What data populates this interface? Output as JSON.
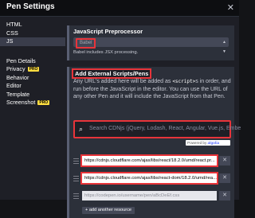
{
  "header": {
    "title": "Pen Settings",
    "close_label": "✕"
  },
  "sidebar": {
    "groups": [
      [
        {
          "label": "HTML"
        },
        {
          "label": "CSS"
        },
        {
          "label": "JS",
          "active": true
        }
      ],
      [
        {
          "label": "Pen Details"
        },
        {
          "label": "Privacy",
          "badge": "PRO"
        },
        {
          "label": "Behavior"
        },
        {
          "label": "Editor"
        },
        {
          "label": "Template"
        },
        {
          "label": "Screenshot",
          "badge": "PRO"
        }
      ]
    ]
  },
  "preprocessor": {
    "title": "JavaScript Preprocessor",
    "selected": "Babel",
    "help": "Babel includes JSX processing."
  },
  "external": {
    "title": "Add External Scripts/Pens",
    "desc_before": "Any URL's added here will be added as ",
    "desc_code": "<script>",
    "desc_after": "s in order, and run before the JavaScript in the editor. You can use the URL of any other Pen and it will include the JavaScript from that Pen.",
    "search_placeholder": "Search CDNjs (jQuery, Lodash, React, Angular, Vue.js, Embe",
    "powered_by": "Powered by",
    "powered_brand": "algolia",
    "resources": [
      {
        "value": "https://cdnjs.cloudflare.com/ajax/libs/react/18.2.0/umd/react.pr..."
      },
      {
        "value": "https://cdnjs.cloudflare.com/ajax/libs/react-dom/18.2.0/umd/rea..."
      }
    ],
    "resource_placeholder": "https://codepen.io/username/pen/aBcDeEf.css",
    "add_label": "+ add another resource"
  },
  "colors": {
    "highlight": "#e8343a",
    "pro_badge": "#ffdd40"
  }
}
